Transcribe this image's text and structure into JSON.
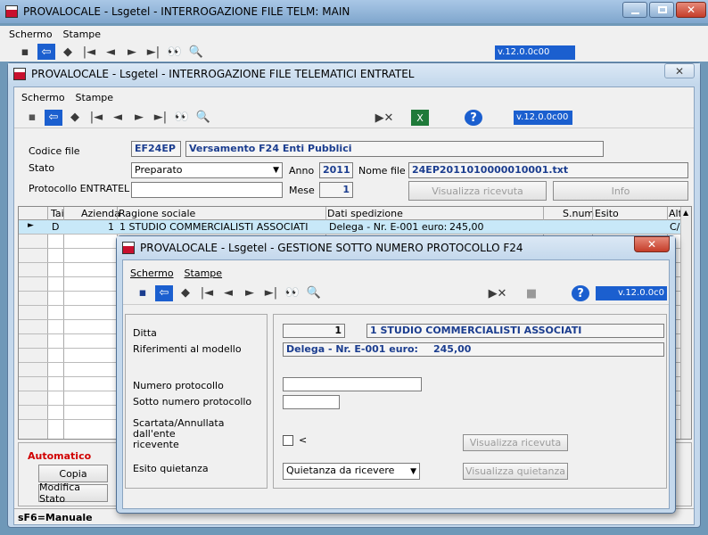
{
  "main_window": {
    "title": "PROVALOCALE - Lsgetel - INTERROGAZIONE FILE TELM: MAIN",
    "menu": [
      "Schermo",
      "Stampe"
    ],
    "version": "v.12.0.0c00"
  },
  "telematici_window": {
    "title": "PROVALOCALE - Lsgetel - INTERROGAZIONE FILE TELEMATICI ENTRATEL",
    "menu": [
      "Schermo",
      "Stampe"
    ],
    "version": "v.12.0.0c00",
    "labels": {
      "codice_file": "Codice file",
      "stato": "Stato",
      "protocollo": "Protocollo ENTRATEL",
      "anno": "Anno",
      "mese": "Mese",
      "nome_file": "Nome file"
    },
    "codice_file": "EF24EP",
    "codice_desc": "Versamento F24 Enti Pubblici",
    "stato": "Preparato",
    "anno": "2011",
    "mese": "1",
    "nome_file": "24EP2011010000010001.txt",
    "protocollo": "",
    "buttons": {
      "visualizza_ricevuta": "Visualizza ricevuta",
      "info": "Info"
    },
    "table": {
      "headers": [
        "Tai",
        "Azienda",
        "Ragione sociale",
        "Dati spedizione",
        "S.num",
        "Esito",
        "Alt"
      ],
      "row": {
        "arrow": "►",
        "tai": "D",
        "azienda": "1",
        "ragione": "1 STUDIO COMMERCIALISTI ASSOCIATI",
        "dati": "Delega - Nr. E-001 euro:",
        "importo": "245,00",
        "alt": "C/"
      }
    },
    "footer": {
      "automatico": "Automatico",
      "copia": "Copia",
      "modifica_stato": "Modifica Stato",
      "status": "sF6=Manuale"
    }
  },
  "protocollo_window": {
    "title": "PROVALOCALE - Lsgetel - GESTIONE SOTTO NUMERO PROTOCOLLO F24",
    "menu": [
      "Schermo",
      "Stampe"
    ],
    "version": "v.12.0.0c0",
    "labels": {
      "ditta": "Ditta",
      "riferimenti": "Riferimenti al modello",
      "numero_protocollo": "Numero protocollo",
      "sotto_numero": "Sotto numero protocollo",
      "scartata": "Scartata/Annullata",
      "dall_ente": "dall'ente",
      "ricevente": "ricevente",
      "esito": "Esito quietanza"
    },
    "ditta_num": "1",
    "ditta_nome": "1 STUDIO COMMERCIALISTI ASSOCIATI",
    "delega": "Delega - Nr. E-001 euro:",
    "importo": "245,00",
    "numero_protocollo": "",
    "sotto_numero": "",
    "scartata_mark": "<",
    "esito": "Quietanza da ricevere",
    "buttons": {
      "visualizza_ricevuta": "Visualizza ricevuta",
      "visualizza_quietanza": "Visualizza quietanza"
    }
  }
}
